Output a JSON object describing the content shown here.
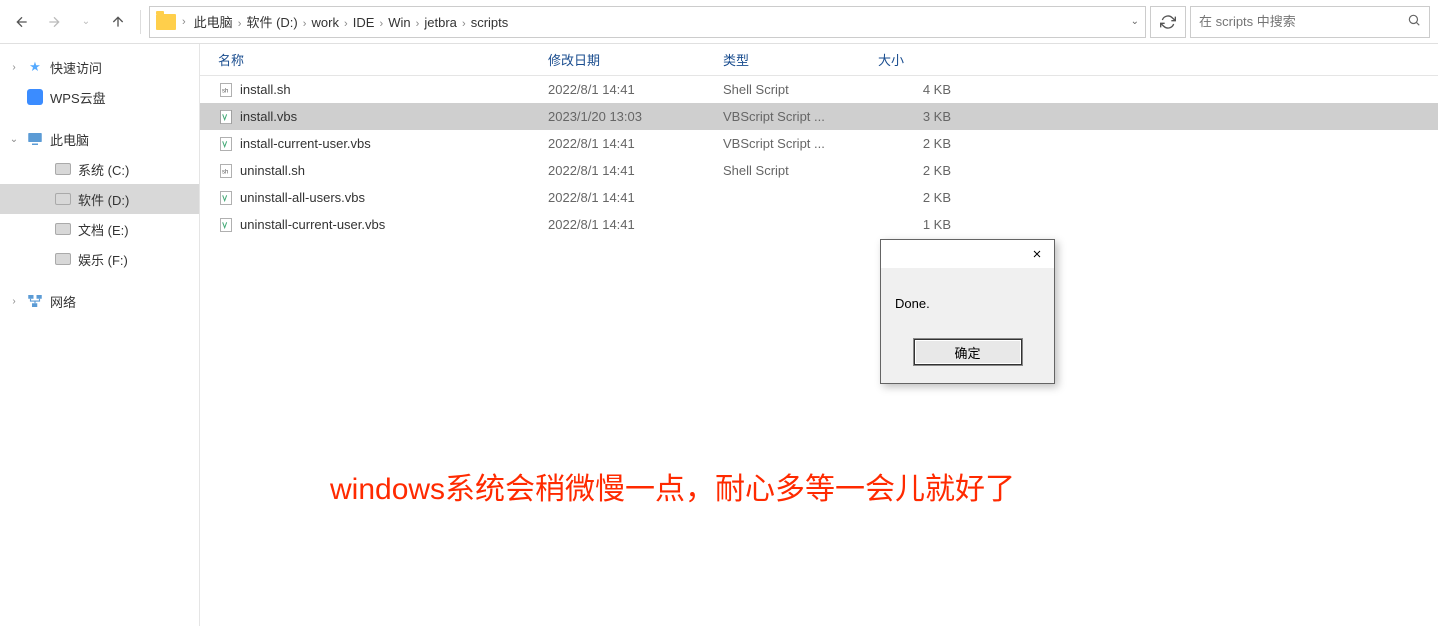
{
  "toolbar": {
    "breadcrumbs": [
      "此电脑",
      "软件 (D:)",
      "work",
      "IDE",
      "Win",
      "jetbra",
      "scripts"
    ],
    "search_placeholder": "在 scripts 中搜索"
  },
  "sidebar": {
    "items": [
      {
        "label": "快速访问",
        "icon": "star",
        "chev": "›",
        "indent": 0
      },
      {
        "label": "WPS云盘",
        "icon": "wps",
        "chev": "",
        "indent": 0
      },
      {
        "label": "此电脑",
        "icon": "pc",
        "chev": "⌄",
        "indent": 0
      },
      {
        "label": "系统 (C:)",
        "icon": "drive",
        "chev": "",
        "indent": 1
      },
      {
        "label": "软件 (D:)",
        "icon": "drive",
        "chev": "",
        "indent": 1,
        "selected": true
      },
      {
        "label": "文档 (E:)",
        "icon": "drive",
        "chev": "",
        "indent": 1
      },
      {
        "label": "娱乐 (F:)",
        "icon": "drive",
        "chev": "",
        "indent": 1
      },
      {
        "label": "网络",
        "icon": "net",
        "chev": "›",
        "indent": 0
      }
    ]
  },
  "columns": {
    "name": "名称",
    "date": "修改日期",
    "type": "类型",
    "size": "大小"
  },
  "files": [
    {
      "name": "install.sh",
      "date": "2022/8/1 14:41",
      "type": "Shell Script",
      "size": "4 KB",
      "icon": "sh"
    },
    {
      "name": "install.vbs",
      "date": "2023/1/20 13:03",
      "type": "VBScript Script ...",
      "size": "3 KB",
      "icon": "vbs",
      "selected": true
    },
    {
      "name": "install-current-user.vbs",
      "date": "2022/8/1 14:41",
      "type": "VBScript Script ...",
      "size": "2 KB",
      "icon": "vbs"
    },
    {
      "name": "uninstall.sh",
      "date": "2022/8/1 14:41",
      "type": "Shell Script",
      "size": "2 KB",
      "icon": "sh"
    },
    {
      "name": "uninstall-all-users.vbs",
      "date": "2022/8/1 14:41",
      "type": "",
      "size": "2 KB",
      "icon": "vbs"
    },
    {
      "name": "uninstall-current-user.vbs",
      "date": "2022/8/1 14:41",
      "type": "",
      "size": "1 KB",
      "icon": "vbs"
    }
  ],
  "dialog": {
    "message": "Done.",
    "ok": "确定"
  },
  "annotation": "windows系统会稍微慢一点，耐心多等一会儿就好了"
}
